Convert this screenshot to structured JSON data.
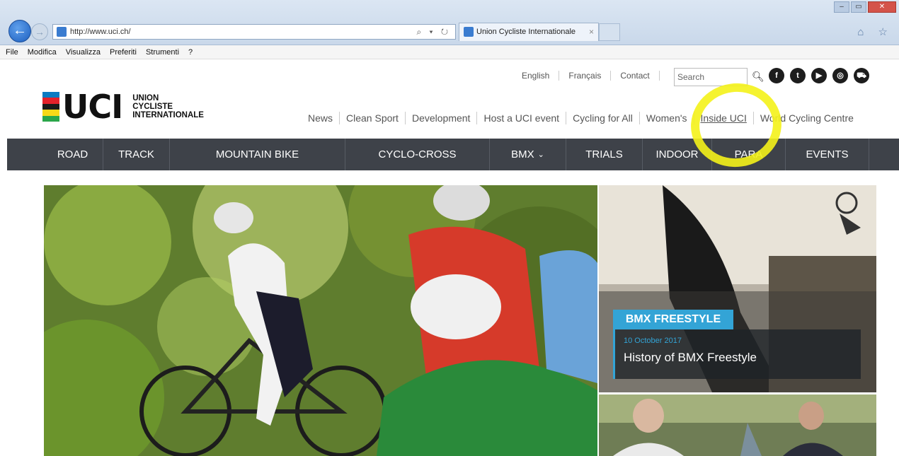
{
  "browser": {
    "url": "http://www.uci.ch/",
    "tab_title": "Union Cycliste Internationale",
    "tab_close": "×",
    "back_glyph": "←",
    "forward_glyph": "→",
    "addr_tools": "⌕ ▾ ↻",
    "home_icons": "⌂ ☆",
    "window_controls": [
      "–",
      "▭",
      "✕"
    ],
    "menu": [
      "File",
      "Modifica",
      "Visualizza",
      "Preferiti",
      "Strumenti",
      "?"
    ]
  },
  "header": {
    "logo": {
      "letters": "UCI",
      "line1": "UNION",
      "line2": "CYCLISTE",
      "line3": "INTERNATIONALE",
      "stripe_colors": [
        "#0a7bc2",
        "#e4222b",
        "#1b1b1b",
        "#f7d917",
        "#2aa64a"
      ]
    },
    "util_links": [
      "English",
      "Français",
      "Contact"
    ],
    "search_placeholder": "Search",
    "social_icons": [
      {
        "name": "facebook-icon",
        "glyph": "f"
      },
      {
        "name": "twitter-icon",
        "glyph": "t"
      },
      {
        "name": "youtube-icon",
        "glyph": "▶"
      },
      {
        "name": "instagram-icon",
        "glyph": "◎"
      },
      {
        "name": "cart-icon",
        "glyph": "⛟"
      }
    ],
    "main_nav": [
      "News",
      "Clean Sport",
      "Development",
      "Host a UCI event",
      "Cycling for All",
      "Women's",
      "Inside UCI",
      "World Cycling Centre"
    ],
    "annotation_color": "#f4f21a"
  },
  "discipline_nav": [
    {
      "label": "ROAD",
      "w": 86
    },
    {
      "label": "TRACK",
      "w": 94
    },
    {
      "label": "MOUNTAIN BIKE",
      "w": 248
    },
    {
      "label": "CYCLO-CROSS",
      "w": 204
    },
    {
      "label": "BMX",
      "w": 108,
      "chev": "⌄"
    },
    {
      "label": "TRIALS",
      "w": 108
    },
    {
      "label": "INDOOR",
      "w": 98
    },
    {
      "label": "PARA",
      "w": 104
    },
    {
      "label": "EVENTS",
      "w": 118
    }
  ],
  "featured": {
    "tag": "BMX FREESTYLE",
    "date": "10 October 2017",
    "title": "History of BMX Freestyle",
    "accent_color": "#33a4d6"
  }
}
